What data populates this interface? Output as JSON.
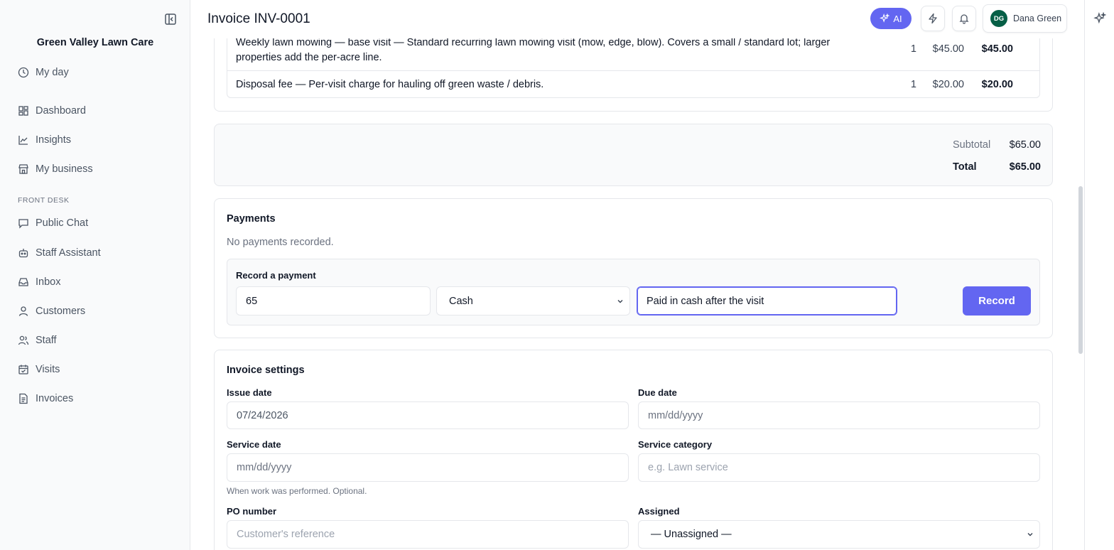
{
  "sidebar": {
    "brand": "Green Valley Lawn Care",
    "items": [
      {
        "label": "My day"
      },
      {
        "label": "Dashboard"
      },
      {
        "label": "Insights"
      },
      {
        "label": "My business"
      },
      {
        "label": "Public Chat"
      },
      {
        "label": "Staff Assistant"
      },
      {
        "label": "Inbox"
      },
      {
        "label": "Customers"
      },
      {
        "label": "Staff"
      },
      {
        "label": "Visits"
      },
      {
        "label": "Invoices"
      }
    ],
    "section_front_desk": "FRONT DESK"
  },
  "header": {
    "title": "Invoice INV-0001",
    "ai_label": "AI",
    "user": {
      "initials": "DG",
      "name": "Dana Green"
    }
  },
  "line_items": [
    {
      "description": "Weekly lawn mowing — base visit — Standard recurring lawn mowing visit (mow, edge, blow). Covers a small / standard lot; larger properties add the per-acre line.",
      "qty": "1",
      "price": "$45.00",
      "amount": "$45.00"
    },
    {
      "description": "Disposal fee — Per-visit charge for hauling off green waste / debris.",
      "qty": "1",
      "price": "$20.00",
      "amount": "$20.00"
    }
  ],
  "totals": {
    "subtotal_label": "Subtotal",
    "subtotal": "$65.00",
    "total_label": "Total",
    "total": "$65.00"
  },
  "payments": {
    "title": "Payments",
    "empty_text": "No payments recorded.",
    "record_title": "Record a payment",
    "amount_value": "65",
    "method_value": "Cash",
    "note_value": "Paid in cash after the visit",
    "record_button": "Record"
  },
  "settings": {
    "title": "Invoice settings",
    "issue_date_label": "Issue date",
    "issue_date_value": "07/24/2026",
    "due_date_label": "Due date",
    "due_date_placeholder": "mm/dd/yyyy",
    "service_date_label": "Service date",
    "service_date_placeholder": "mm/dd/yyyy",
    "service_date_hint": "When work was performed. Optional.",
    "service_category_label": "Service category",
    "service_category_placeholder": "e.g. Lawn service",
    "po_number_label": "PO number",
    "po_number_placeholder": "Customer's reference",
    "assigned_label": "Assigned",
    "assigned_value": "— Unassigned —"
  },
  "colors": {
    "accent": "#6366f1",
    "avatar": "#065f46"
  }
}
